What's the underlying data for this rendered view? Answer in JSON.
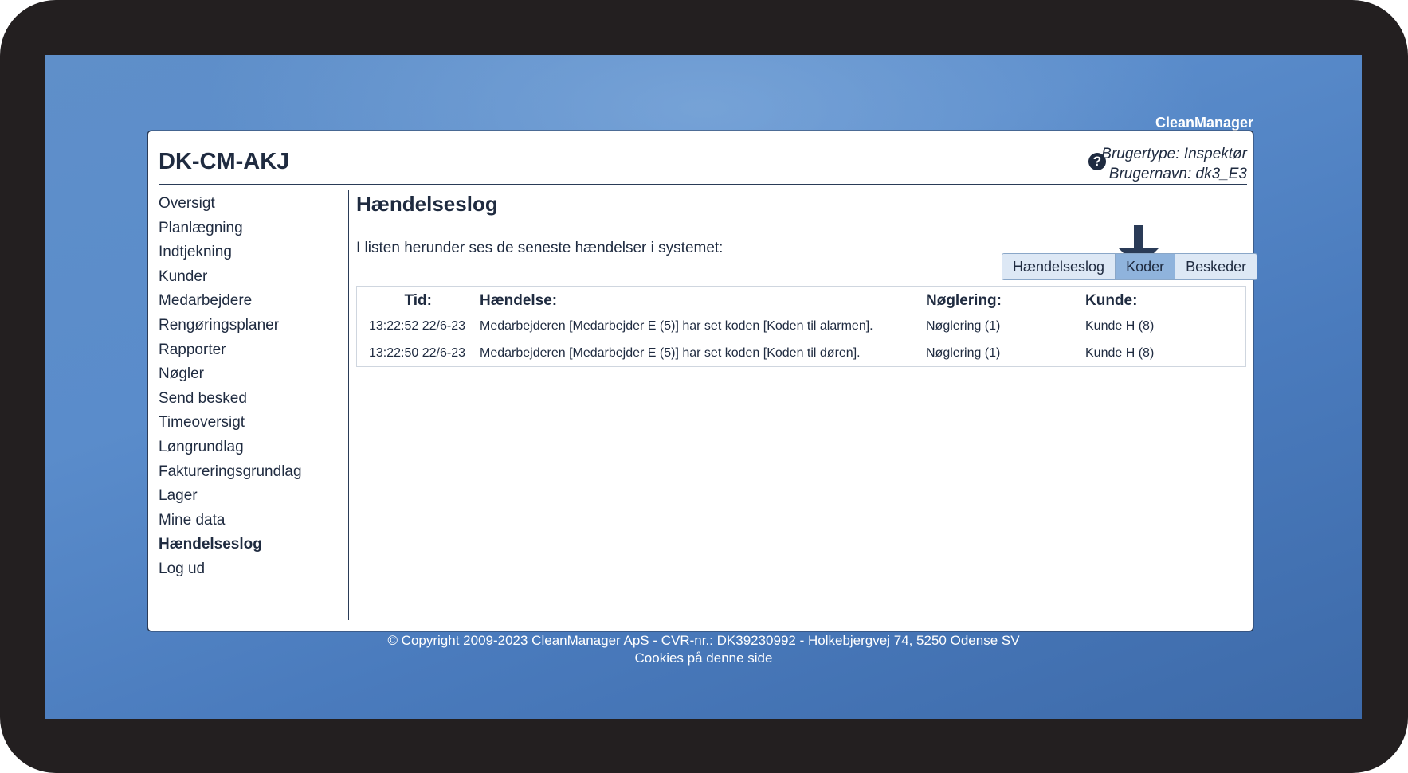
{
  "brand": "CleanManager",
  "panel": {
    "title": "DK-CM-AKJ",
    "help_icon": "help-question-icon",
    "user_type": "Brugertype: Inspektør",
    "user_name": "Brugernavn: dk3_E3"
  },
  "sidebar": {
    "items": [
      {
        "label": "Oversigt"
      },
      {
        "label": "Planlægning"
      },
      {
        "label": "Indtjekning"
      },
      {
        "label": "Kunder"
      },
      {
        "label": "Medarbejdere"
      },
      {
        "label": "Rengøringsplaner"
      },
      {
        "label": "Rapporter"
      },
      {
        "label": "Nøgler"
      },
      {
        "label": "Send besked"
      },
      {
        "label": "Timeoversigt"
      },
      {
        "label": "Løngrundlag"
      },
      {
        "label": "Faktureringsgrundlag"
      },
      {
        "label": "Lager"
      },
      {
        "label": "Mine data"
      },
      {
        "label": "Hændelseslog",
        "active": true
      },
      {
        "label": "Log ud"
      }
    ]
  },
  "main": {
    "title": "Hændelseslog",
    "intro": "I listen herunder ses de seneste hændelser i systemet:",
    "tabs": [
      {
        "label": "Hændelseslog"
      },
      {
        "label": "Koder",
        "active": true
      },
      {
        "label": "Beskeder"
      }
    ],
    "annotation_arrow_color": "#2a3b57",
    "table": {
      "headers": [
        "Tid:",
        "Hændelse:",
        "Nøglering:",
        "Kunde:"
      ],
      "rows": [
        [
          "13:22:52 22/6-23",
          "Medarbejderen [Medarbejder E (5)] har set koden [Koden til alarmen].",
          "Nøglering (1)",
          "Kunde H (8)"
        ],
        [
          "13:22:50 22/6-23",
          "Medarbejderen [Medarbejder E (5)] har set koden [Koden til døren].",
          "Nøglering (1)",
          "Kunde H (8)"
        ]
      ]
    }
  },
  "footer": {
    "copyright": "© Copyright 2009-2023 CleanManager ApS - CVR-nr.: DK39230992 - Holkebjergvej 74, 5250 Odense SV",
    "cookies": "Cookies på denne side"
  }
}
